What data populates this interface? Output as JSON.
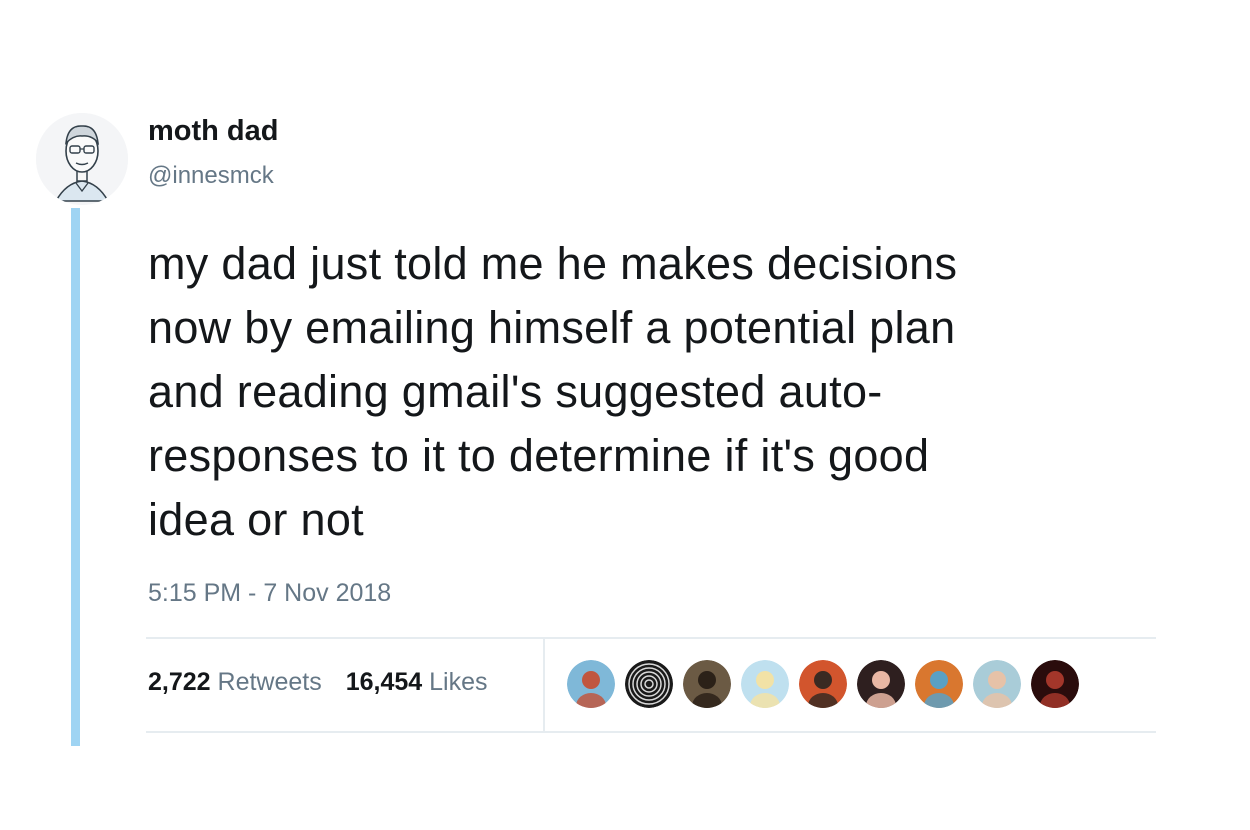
{
  "tweet": {
    "display_name": "moth dad",
    "handle": "@innesmck",
    "text": "my dad just told me he makes decisions\nnow by emailing himself a potential plan\nand reading gmail's suggested auto-\nresponses to it to determine if it's good\nidea or not",
    "timestamp": "5:15 PM - 7 Nov 2018"
  },
  "stats": {
    "retweets_count": "2,722",
    "retweets_label": "Retweets",
    "likes_count": "16,454",
    "likes_label": "Likes"
  },
  "likers": [
    {
      "name": "liker-avatar-1",
      "bg": "#7fb8d8",
      "fg": "#c0563f"
    },
    {
      "name": "liker-avatar-2",
      "bg": "#1a1a1a",
      "fg": "#d9d9d9"
    },
    {
      "name": "liker-avatar-3",
      "bg": "#6b5a44",
      "fg": "#2b2118"
    },
    {
      "name": "liker-avatar-4",
      "bg": "#bfe0ef",
      "fg": "#f2e2a6"
    },
    {
      "name": "liker-avatar-5",
      "bg": "#d2552d",
      "fg": "#3a2a22"
    },
    {
      "name": "liker-avatar-6",
      "bg": "#2e1f1f",
      "fg": "#e9b7a4"
    },
    {
      "name": "liker-avatar-7",
      "bg": "#d9772f",
      "fg": "#5aa0c4"
    },
    {
      "name": "liker-avatar-8",
      "bg": "#a9ccd8",
      "fg": "#e6c2a8"
    },
    {
      "name": "liker-avatar-9",
      "bg": "#2a0c0c",
      "fg": "#a3362a"
    }
  ],
  "colors": {
    "thread_line": "#9fd4f3",
    "secondary_text": "#657786",
    "primary_text": "#14171a",
    "divider": "#e6ecf0"
  },
  "icons": {
    "profile_avatar": "sketch-man-avatar-icon"
  }
}
